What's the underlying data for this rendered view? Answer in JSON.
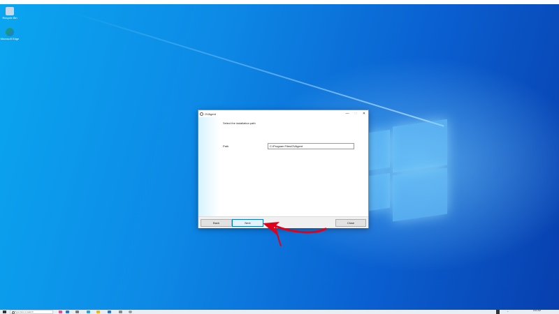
{
  "desktop": {
    "icons": [
      {
        "label": "Recycle Bin",
        "icon": "recycle-bin-icon",
        "color": "#c8d8e8"
      },
      {
        "label": "Microsoft Edge",
        "icon": "edge-icon",
        "color": "#1fa35a"
      }
    ]
  },
  "dialog": {
    "title": "OVAgent",
    "heading": "Select the installation path",
    "path_label": "Path",
    "path_value": "C:\\Program Files\\OVAgent",
    "buttons": {
      "back": "Back",
      "next": "Next",
      "close": "Close"
    },
    "controls": {
      "minimize": "—",
      "maximize": "□",
      "close": "✕"
    }
  },
  "taskbar": {
    "search_placeholder": "Type here to search",
    "clock": "9:03 AM"
  },
  "colors": {
    "accent": "#0078d7",
    "arrow": "#e0001a"
  }
}
